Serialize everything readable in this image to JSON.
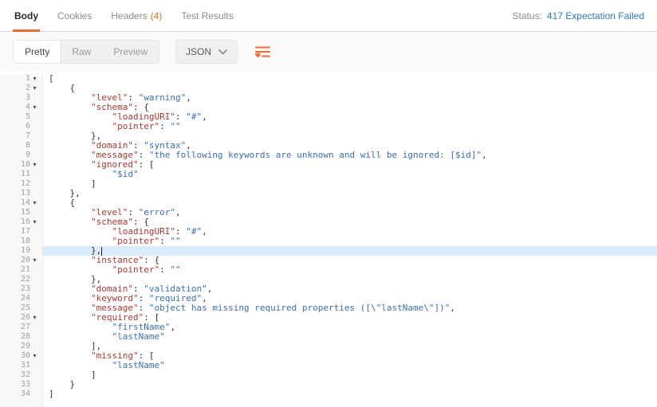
{
  "colors": {
    "accent": "#F26B35",
    "status_blue": "#2E7BC4",
    "count_orange": "#CE7A2B",
    "key": "#A63A34",
    "string": "#3B6FB5",
    "active_line": "#D9ECF9"
  },
  "tabs": {
    "body": {
      "label": "Body"
    },
    "cookies": {
      "label": "Cookies"
    },
    "headers": {
      "label": "Headers",
      "count": "(4)"
    },
    "test_results": {
      "label": "Test Results"
    }
  },
  "status": {
    "label": "Status:",
    "value": "417 Expectation Failed"
  },
  "toolbar": {
    "modes": {
      "pretty": "Pretty",
      "raw": "Raw",
      "preview": "Preview"
    },
    "active_mode": "Pretty",
    "language": "JSON"
  },
  "editor": {
    "active_line": 19,
    "lines": [
      {
        "n": 1,
        "fold": true,
        "tokens": [
          [
            "p",
            "["
          ]
        ]
      },
      {
        "n": 2,
        "fold": true,
        "tokens": [
          [
            "p",
            "    {"
          ]
        ]
      },
      {
        "n": 3,
        "fold": false,
        "tokens": [
          [
            "p",
            "        "
          ],
          [
            "k",
            "\"level\""
          ],
          [
            "p",
            ": "
          ],
          [
            "s",
            "\"warning\""
          ],
          [
            "p",
            ","
          ]
        ]
      },
      {
        "n": 4,
        "fold": true,
        "tokens": [
          [
            "p",
            "        "
          ],
          [
            "k",
            "\"schema\""
          ],
          [
            "p",
            ": {"
          ]
        ]
      },
      {
        "n": 5,
        "fold": false,
        "tokens": [
          [
            "p",
            "            "
          ],
          [
            "k",
            "\"loadingURI\""
          ],
          [
            "p",
            ": "
          ],
          [
            "s",
            "\"#\""
          ],
          [
            "p",
            ","
          ]
        ]
      },
      {
        "n": 6,
        "fold": false,
        "tokens": [
          [
            "p",
            "            "
          ],
          [
            "k",
            "\"pointer\""
          ],
          [
            "p",
            ": "
          ],
          [
            "s",
            "\"\""
          ]
        ]
      },
      {
        "n": 7,
        "fold": false,
        "tokens": [
          [
            "p",
            "        },"
          ]
        ]
      },
      {
        "n": 8,
        "fold": false,
        "tokens": [
          [
            "p",
            "        "
          ],
          [
            "k",
            "\"domain\""
          ],
          [
            "p",
            ": "
          ],
          [
            "s",
            "\"syntax\""
          ],
          [
            "p",
            ","
          ]
        ]
      },
      {
        "n": 9,
        "fold": false,
        "tokens": [
          [
            "p",
            "        "
          ],
          [
            "k",
            "\"message\""
          ],
          [
            "p",
            ": "
          ],
          [
            "s",
            "\"the following keywords are unknown and will be ignored: [$id]\""
          ],
          [
            "p",
            ","
          ]
        ]
      },
      {
        "n": 10,
        "fold": true,
        "tokens": [
          [
            "p",
            "        "
          ],
          [
            "k",
            "\"ignored\""
          ],
          [
            "p",
            ": ["
          ]
        ]
      },
      {
        "n": 11,
        "fold": false,
        "tokens": [
          [
            "p",
            "            "
          ],
          [
            "s",
            "\"$id\""
          ]
        ]
      },
      {
        "n": 12,
        "fold": false,
        "tokens": [
          [
            "p",
            "        ]"
          ]
        ]
      },
      {
        "n": 13,
        "fold": false,
        "tokens": [
          [
            "p",
            "    },"
          ]
        ]
      },
      {
        "n": 14,
        "fold": true,
        "tokens": [
          [
            "p",
            "    {"
          ]
        ]
      },
      {
        "n": 15,
        "fold": false,
        "tokens": [
          [
            "p",
            "        "
          ],
          [
            "k",
            "\"level\""
          ],
          [
            "p",
            ": "
          ],
          [
            "s",
            "\"error\""
          ],
          [
            "p",
            ","
          ]
        ]
      },
      {
        "n": 16,
        "fold": true,
        "tokens": [
          [
            "p",
            "        "
          ],
          [
            "k",
            "\"schema\""
          ],
          [
            "p",
            ": {"
          ]
        ]
      },
      {
        "n": 17,
        "fold": false,
        "tokens": [
          [
            "p",
            "            "
          ],
          [
            "k",
            "\"loadingURI\""
          ],
          [
            "p",
            ": "
          ],
          [
            "s",
            "\"#\""
          ],
          [
            "p",
            ","
          ]
        ]
      },
      {
        "n": 18,
        "fold": false,
        "tokens": [
          [
            "p",
            "            "
          ],
          [
            "k",
            "\"pointer\""
          ],
          [
            "p",
            ": "
          ],
          [
            "s",
            "\"\""
          ]
        ]
      },
      {
        "n": 19,
        "fold": false,
        "cursor": true,
        "tokens": [
          [
            "p",
            "        },"
          ]
        ]
      },
      {
        "n": 20,
        "fold": true,
        "tokens": [
          [
            "p",
            "        "
          ],
          [
            "k",
            "\"instance\""
          ],
          [
            "p",
            ": {"
          ]
        ]
      },
      {
        "n": 21,
        "fold": false,
        "tokens": [
          [
            "p",
            "            "
          ],
          [
            "k",
            "\"pointer\""
          ],
          [
            "p",
            ": "
          ],
          [
            "s",
            "\"\""
          ]
        ]
      },
      {
        "n": 22,
        "fold": false,
        "tokens": [
          [
            "p",
            "        },"
          ]
        ]
      },
      {
        "n": 23,
        "fold": false,
        "tokens": [
          [
            "p",
            "        "
          ],
          [
            "k",
            "\"domain\""
          ],
          [
            "p",
            ": "
          ],
          [
            "s",
            "\"validation\""
          ],
          [
            "p",
            ","
          ]
        ]
      },
      {
        "n": 24,
        "fold": false,
        "tokens": [
          [
            "p",
            "        "
          ],
          [
            "k",
            "\"keyword\""
          ],
          [
            "p",
            ": "
          ],
          [
            "s",
            "\"required\""
          ],
          [
            "p",
            ","
          ]
        ]
      },
      {
        "n": 25,
        "fold": false,
        "tokens": [
          [
            "p",
            "        "
          ],
          [
            "k",
            "\"message\""
          ],
          [
            "p",
            ": "
          ],
          [
            "s",
            "\"object has missing required properties ([\\\"lastName\\\"])\""
          ],
          [
            "p",
            ","
          ]
        ]
      },
      {
        "n": 26,
        "fold": true,
        "tokens": [
          [
            "p",
            "        "
          ],
          [
            "k",
            "\"required\""
          ],
          [
            "p",
            ": ["
          ]
        ]
      },
      {
        "n": 27,
        "fold": false,
        "tokens": [
          [
            "p",
            "            "
          ],
          [
            "s",
            "\"firstName\""
          ],
          [
            "p",
            ","
          ]
        ]
      },
      {
        "n": 28,
        "fold": false,
        "tokens": [
          [
            "p",
            "            "
          ],
          [
            "s",
            "\"lastName\""
          ]
        ]
      },
      {
        "n": 29,
        "fold": false,
        "tokens": [
          [
            "p",
            "        ],"
          ]
        ]
      },
      {
        "n": 30,
        "fold": true,
        "tokens": [
          [
            "p",
            "        "
          ],
          [
            "k",
            "\"missing\""
          ],
          [
            "p",
            ": ["
          ]
        ]
      },
      {
        "n": 31,
        "fold": false,
        "tokens": [
          [
            "p",
            "            "
          ],
          [
            "s",
            "\"lastName\""
          ]
        ]
      },
      {
        "n": 32,
        "fold": false,
        "tokens": [
          [
            "p",
            "        ]"
          ]
        ]
      },
      {
        "n": 33,
        "fold": false,
        "tokens": [
          [
            "p",
            "    }"
          ]
        ]
      },
      {
        "n": 34,
        "fold": false,
        "tokens": [
          [
            "p",
            "]"
          ]
        ]
      }
    ]
  }
}
